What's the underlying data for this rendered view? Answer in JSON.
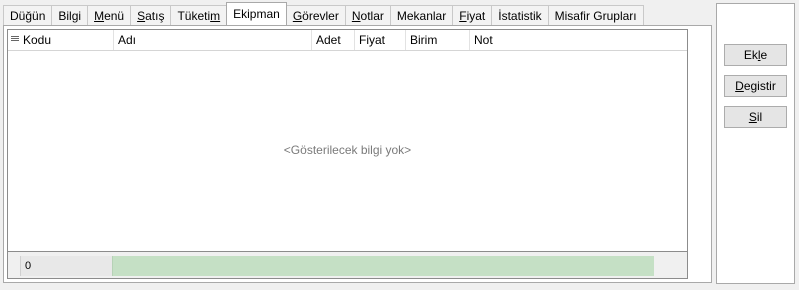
{
  "tabs": [
    {
      "pre": "",
      "u": "",
      "post": "Düğün"
    },
    {
      "pre": "",
      "u": "",
      "post": "Bilgi"
    },
    {
      "pre": "",
      "u": "M",
      "post": "enü"
    },
    {
      "pre": "",
      "u": "S",
      "post": "atış"
    },
    {
      "pre": "Tüketi",
      "u": "m",
      "post": ""
    },
    {
      "pre": "",
      "u": "",
      "post": "Ekipman"
    },
    {
      "pre": "",
      "u": "G",
      "post": "örevler"
    },
    {
      "pre": "",
      "u": "N",
      "post": "otlar"
    },
    {
      "pre": "",
      "u": "",
      "post": "Mekanlar"
    },
    {
      "pre": "",
      "u": "F",
      "post": "iyat"
    },
    {
      "pre": "",
      "u": "",
      "post": "İstatistik"
    },
    {
      "pre": "",
      "u": "",
      "post": "Misafir Grupları"
    }
  ],
  "grid": {
    "columns": [
      "Kodu",
      "Adı",
      "Adet",
      "Fiyat",
      "Birim",
      "Not"
    ],
    "empty_text": "<Gösterilecek bilgi yok>",
    "footer_value": "0"
  },
  "buttons": [
    {
      "pre": "Ek",
      "u": "l",
      "post": "e"
    },
    {
      "pre": "",
      "u": "D",
      "post": "egistir"
    },
    {
      "pre": "",
      "u": "S",
      "post": "il"
    }
  ]
}
